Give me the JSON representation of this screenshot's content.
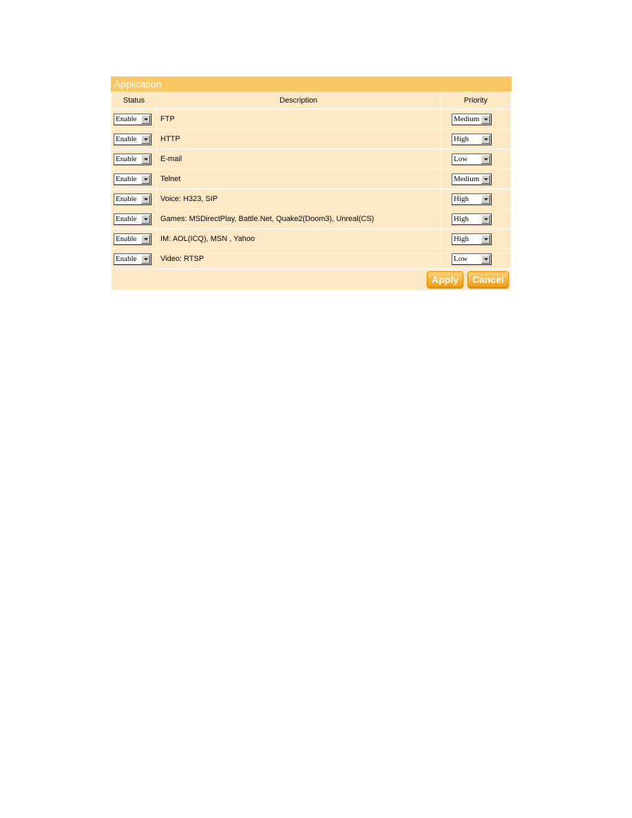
{
  "panel": {
    "title": "Application"
  },
  "columns": {
    "status": "Status",
    "description": "Description",
    "priority": "Priority"
  },
  "rows": [
    {
      "status": "Enable",
      "description": "FTP",
      "priority": "Medium"
    },
    {
      "status": "Enable",
      "description": "HTTP",
      "priority": "High"
    },
    {
      "status": "Enable",
      "description": "E-mail",
      "priority": "Low"
    },
    {
      "status": "Enable",
      "description": "Telnet",
      "priority": "Medium"
    },
    {
      "status": "Enable",
      "description": "Voice: H323, SIP",
      "priority": "High"
    },
    {
      "status": "Enable",
      "description": "Games: MSDirectPlay, Battle.Net, Quake2(Doom3), Unreal(CS)",
      "priority": "High"
    },
    {
      "status": "Enable",
      "description": "IM: AOL(ICQ), MSN , Yahoo",
      "priority": "High"
    },
    {
      "status": "Enable",
      "description": "Video: RTSP",
      "priority": "Low"
    }
  ],
  "buttons": {
    "apply": "Apply",
    "cancel": "Cancel"
  },
  "colors": {
    "header": "#fbc763",
    "row": "#fde9c6",
    "button": "#f29a11"
  }
}
